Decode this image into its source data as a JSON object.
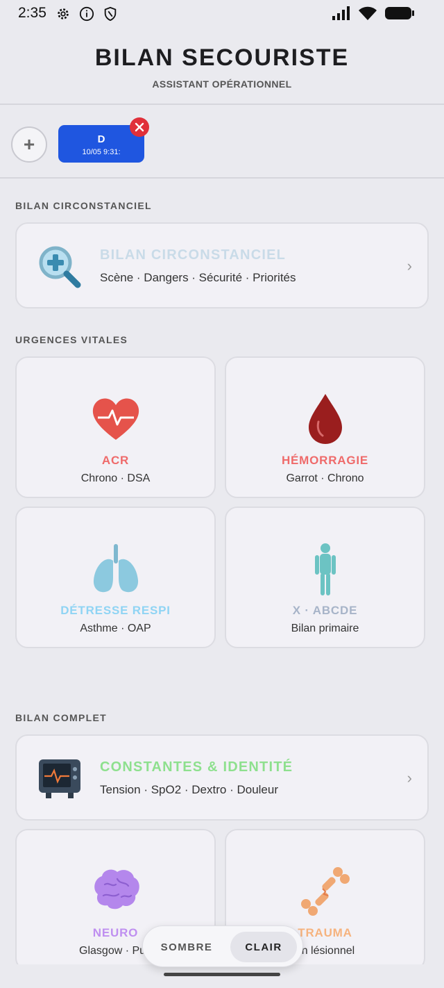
{
  "status": {
    "time": "2:35"
  },
  "header": {
    "title": "BILAN SECOURISTE",
    "subtitle": "ASSISTANT OPÉRATIONNEL"
  },
  "sessions": {
    "add_label": "+",
    "items": [
      {
        "name": "D",
        "date": "10/05 9:31:"
      }
    ]
  },
  "sections": {
    "circonstanciel": "BILAN CIRCONSTANCIEL",
    "urgences": "URGENCES VITALES",
    "complet": "BILAN COMPLET"
  },
  "circ_card": {
    "title": "BILAN CIRCONSTANCIEL",
    "sub": "Scène · Dangers · Sécurité · Priorités",
    "color": "#c9dbe8",
    "icon": "magnifier-plus-icon"
  },
  "tiles": [
    {
      "title": "ACR",
      "sub": "Chrono · DSA",
      "color": "#ef6a6a",
      "icon": "heart-pulse-icon"
    },
    {
      "title": "HÉMORRAGIE",
      "sub": "Garrot · Chrono",
      "color": "#ef6a6a",
      "icon": "blood-drop-icon"
    },
    {
      "title": "DÉTRESSE RESPI",
      "sub": "Asthme · OAP",
      "color": "#8fd4f4",
      "icon": "lungs-icon"
    },
    {
      "title": "X · ABCDE",
      "sub": "Bilan primaire",
      "color": "#a7b4c8",
      "icon": "human-figure-icon"
    }
  ],
  "constantes_card": {
    "title": "CONSTANTES & IDENTITÉ",
    "sub": "Tension · SpO2 · Dextro · Douleur",
    "color": "#8ee08e",
    "icon": "monitor-icon"
  },
  "complet_tiles": [
    {
      "title": "NEURO",
      "sub": "Glasgow · Pup",
      "color": "#bf8ff0",
      "icon": "brain-icon"
    },
    {
      "title": "TRAUMA",
      "sub": "an lésionnel",
      "color": "#f6b37e",
      "icon": "broken-bone-icon"
    }
  ],
  "theme": {
    "dark": "SOMBRE",
    "light": "CLAIR"
  }
}
